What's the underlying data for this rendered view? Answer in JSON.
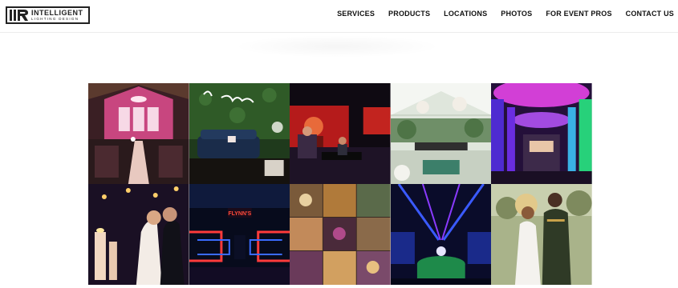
{
  "brand": {
    "name": "INTELLIGENT",
    "tagline": "LIGHTING DESIGN"
  },
  "nav": {
    "items": [
      {
        "label": "SERVICES"
      },
      {
        "label": "PRODUCTS"
      },
      {
        "label": "LOCATIONS"
      },
      {
        "label": "PHOTOS"
      },
      {
        "label": "FOR EVENT PROS"
      },
      {
        "label": "CONTACT US"
      }
    ]
  },
  "gallery": {
    "photos": [
      {
        "subject": "pink-lit wedding ceremony barn"
      },
      {
        "subject": "greenery wall lounge with script sign",
        "sign_text": "the Millikens"
      },
      {
        "subject": "stage performer with red screens"
      },
      {
        "subject": "greenhouse reception with chandeliers"
      },
      {
        "subject": "purple and green uplit hall"
      },
      {
        "subject": "couple kissing with candles"
      },
      {
        "subject": "neon tunnel dance floor",
        "sign_text": "FLYNN'S"
      },
      {
        "subject": "collage of event setups"
      },
      {
        "subject": "blue lit ballroom with green table"
      },
      {
        "subject": "bride and groom outdoors"
      }
    ]
  },
  "colors": {
    "nav_text": "#111111",
    "logo_border": "#222222",
    "header_border": "#ececec"
  }
}
